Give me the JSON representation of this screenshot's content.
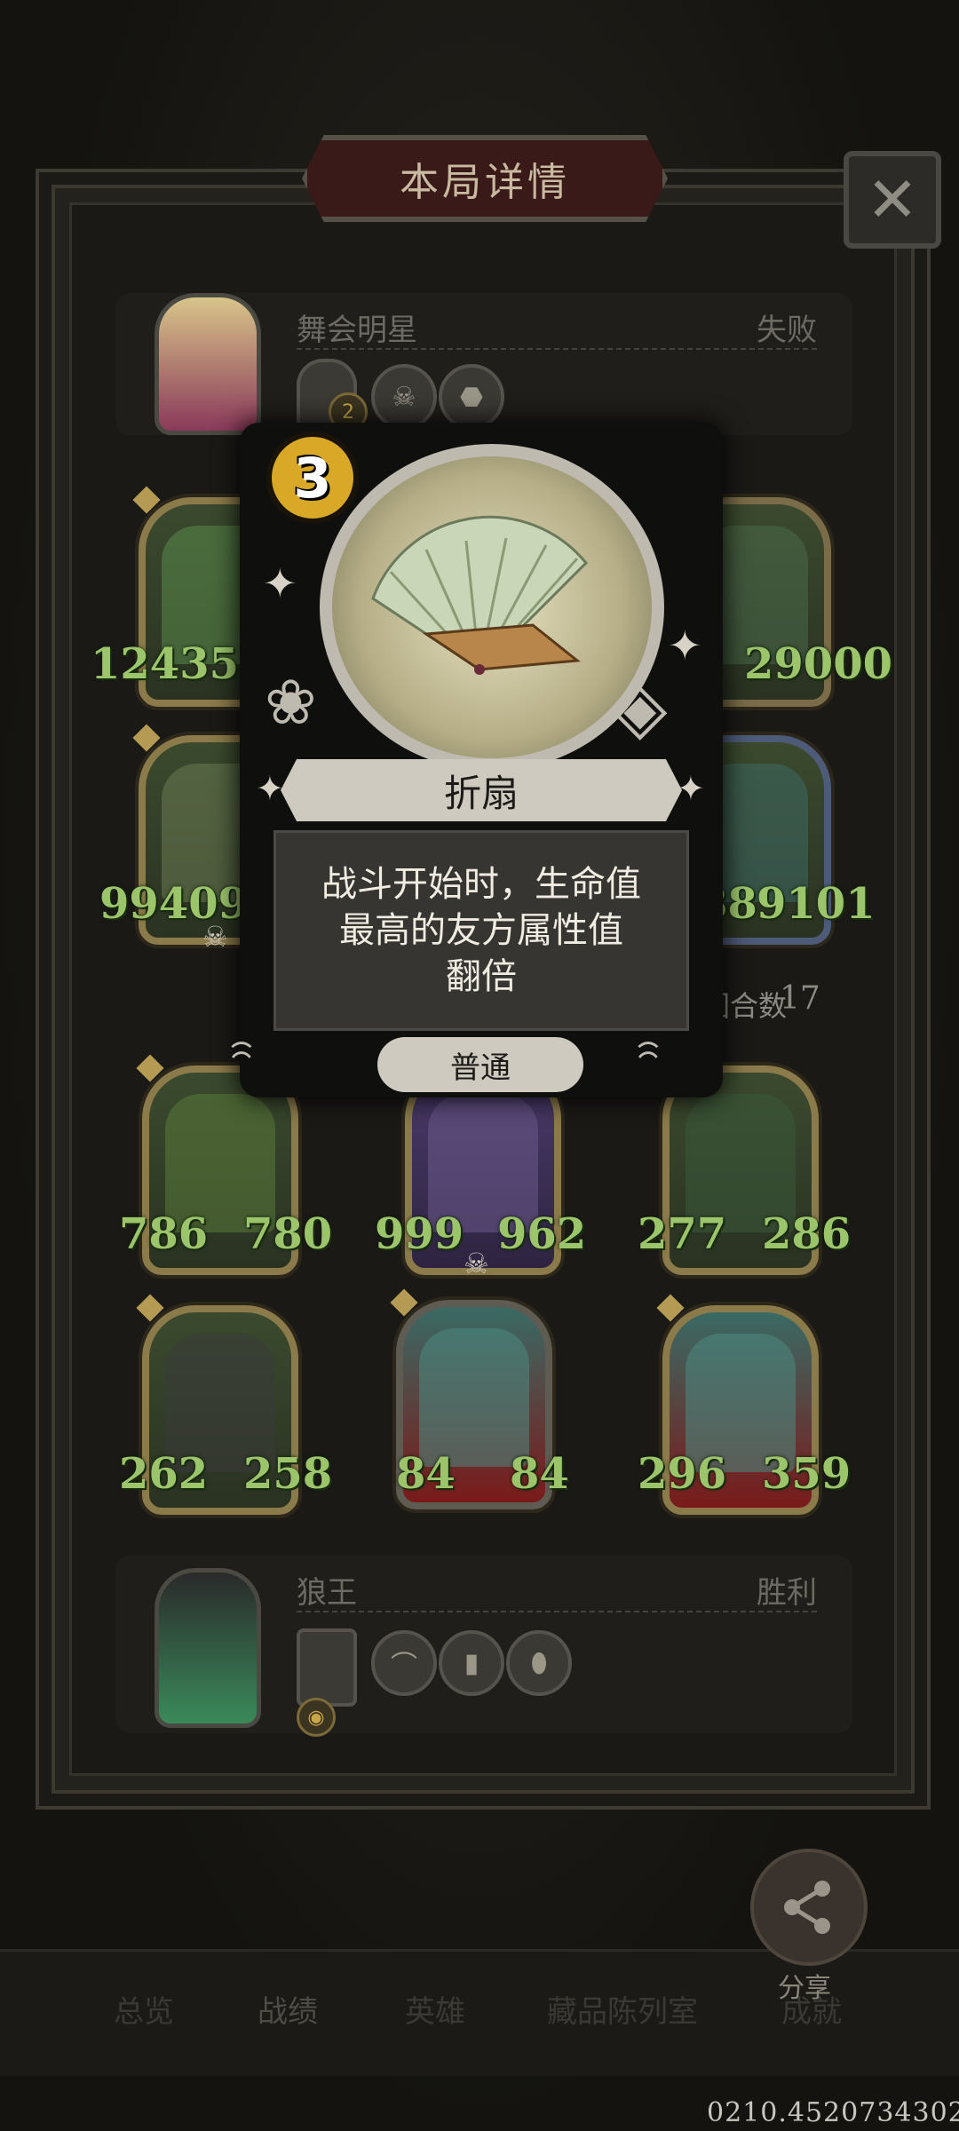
{
  "header": {
    "title": "本局详情",
    "close_symbol": "✕"
  },
  "top_player": {
    "name": "舞会明星",
    "result": "失败",
    "hero_level": "2",
    "items": [
      "skeleton-item-icon",
      "beast-item-icon"
    ]
  },
  "enemy_board": [
    {
      "attack": "124358",
      "health": "",
      "icon": "dryad-hero",
      "dead": false
    },
    {
      "attack": "",
      "health": "29000",
      "icon": "goblin-knight-hero",
      "dead": false
    },
    {
      "attack": "99409",
      "health": "",
      "icon": "flower-mage-hero",
      "dead": true
    },
    {
      "attack": "88",
      "health": "9101",
      "icon": "fairy-hero",
      "dead": false
    }
  ],
  "round_info": {
    "label": "回合数",
    "value": "17"
  },
  "player_board": [
    {
      "attack": "786",
      "health": "780",
      "icon": "dragon-hero",
      "dead": false
    },
    {
      "attack": "999",
      "health": "962",
      "icon": "horned-beast-hero",
      "dead": true
    },
    {
      "attack": "277",
      "health": "286",
      "icon": "reaper-hero",
      "dead": false
    },
    {
      "attack": "262",
      "health": "258",
      "icon": "skull-witch-hero",
      "dead": false
    },
    {
      "attack": "84",
      "health": "84",
      "icon": "ghost-hero",
      "dead": false
    },
    {
      "attack": "296",
      "health": "359",
      "icon": "ghost-hero",
      "dead": false
    }
  ],
  "bottom_player": {
    "name": "狼王",
    "result": "胜利",
    "items": [
      "fan-item-icon",
      "book-item-icon",
      "jar-item-icon"
    ]
  },
  "popup": {
    "tier": "3",
    "name": "折扇",
    "description": "战斗开始时，生命值\n最高的友方属性值\n翻倍",
    "rarity": "普通",
    "art_icon": "folding-fan-icon"
  },
  "tabs": [
    {
      "label": "总览",
      "active": false
    },
    {
      "label": "战绩",
      "active": true
    },
    {
      "label": "英雄",
      "active": false
    },
    {
      "label": "藏品陈列室",
      "active": false
    },
    {
      "label": "成就",
      "active": false
    }
  ],
  "share": {
    "label": "分享",
    "icon": "share-icon"
  },
  "footer_id": "0210.4520734302",
  "colors": {
    "stat_green": "#9cc56b",
    "tier_gold": "#d8a826",
    "title_red": "#3a1a18"
  }
}
